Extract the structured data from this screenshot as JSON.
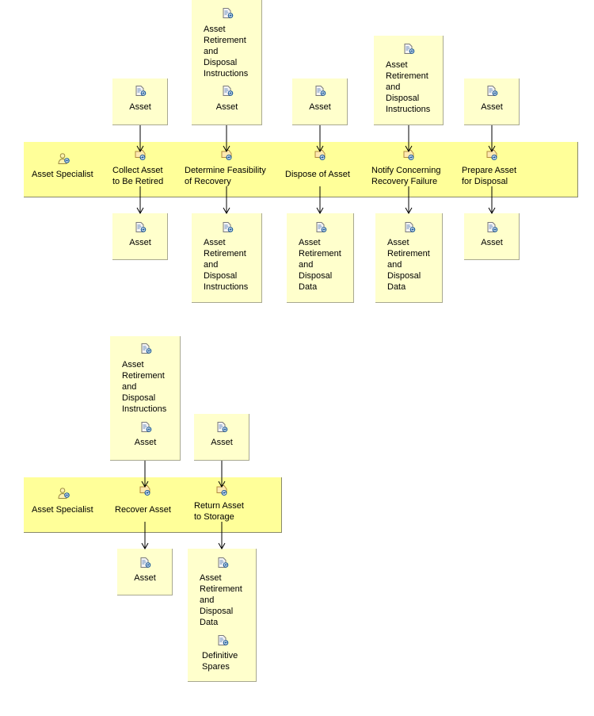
{
  "diagram": {
    "lanes": [
      {
        "role": "Asset Specialist",
        "tasks": [
          {
            "name": "Collect Asset\nto Be Retired",
            "inputs": [
              [
                "Asset"
              ]
            ],
            "outputs": [
              [
                "Asset"
              ]
            ]
          },
          {
            "name": "Determine Feasibility\nof Recovery",
            "inputs": [
              [
                "Asset\nRetirement\nand\nDisposal\nInstructions",
                "Asset"
              ]
            ],
            "outputs": [
              [
                "Asset\nRetirement\nand\nDisposal\nInstructions"
              ]
            ]
          },
          {
            "name": "Dispose of Asset",
            "inputs": [
              [
                "Asset"
              ]
            ],
            "outputs": [
              [
                "Asset\nRetirement\nand\nDisposal\nData"
              ]
            ]
          },
          {
            "name": "Notify Concerning\nRecovery Failure",
            "inputs": [
              [
                "Asset\nRetirement\nand\nDisposal\nInstructions"
              ]
            ],
            "outputs": [
              [
                "Asset\nRetirement\nand\nDisposal\nData"
              ]
            ]
          },
          {
            "name": "Prepare Asset\nfor Disposal",
            "inputs": [
              [
                "Asset"
              ]
            ],
            "outputs": [
              [
                "Asset"
              ]
            ]
          }
        ]
      },
      {
        "role": "Asset Specialist",
        "tasks": [
          {
            "name": "Recover Asset",
            "inputs": [
              [
                "Asset\nRetirement\nand\nDisposal\nInstructions",
                "Asset"
              ]
            ],
            "outputs": [
              [
                "Asset"
              ]
            ]
          },
          {
            "name": "Return Asset\nto Storage",
            "inputs": [
              [
                "Asset"
              ]
            ],
            "outputs": [
              [
                "Asset\nRetirement\nand\nDisposal\nData",
                "Definitive\nSpares"
              ]
            ]
          }
        ]
      }
    ],
    "colors": {
      "lane_fill": "#ffff99",
      "artifact_fill": "#ffffcc",
      "connector": "#000000"
    },
    "icons": {
      "role": "role-person-icon",
      "task": "task-icon",
      "artifact": "artifact-document-icon"
    }
  }
}
